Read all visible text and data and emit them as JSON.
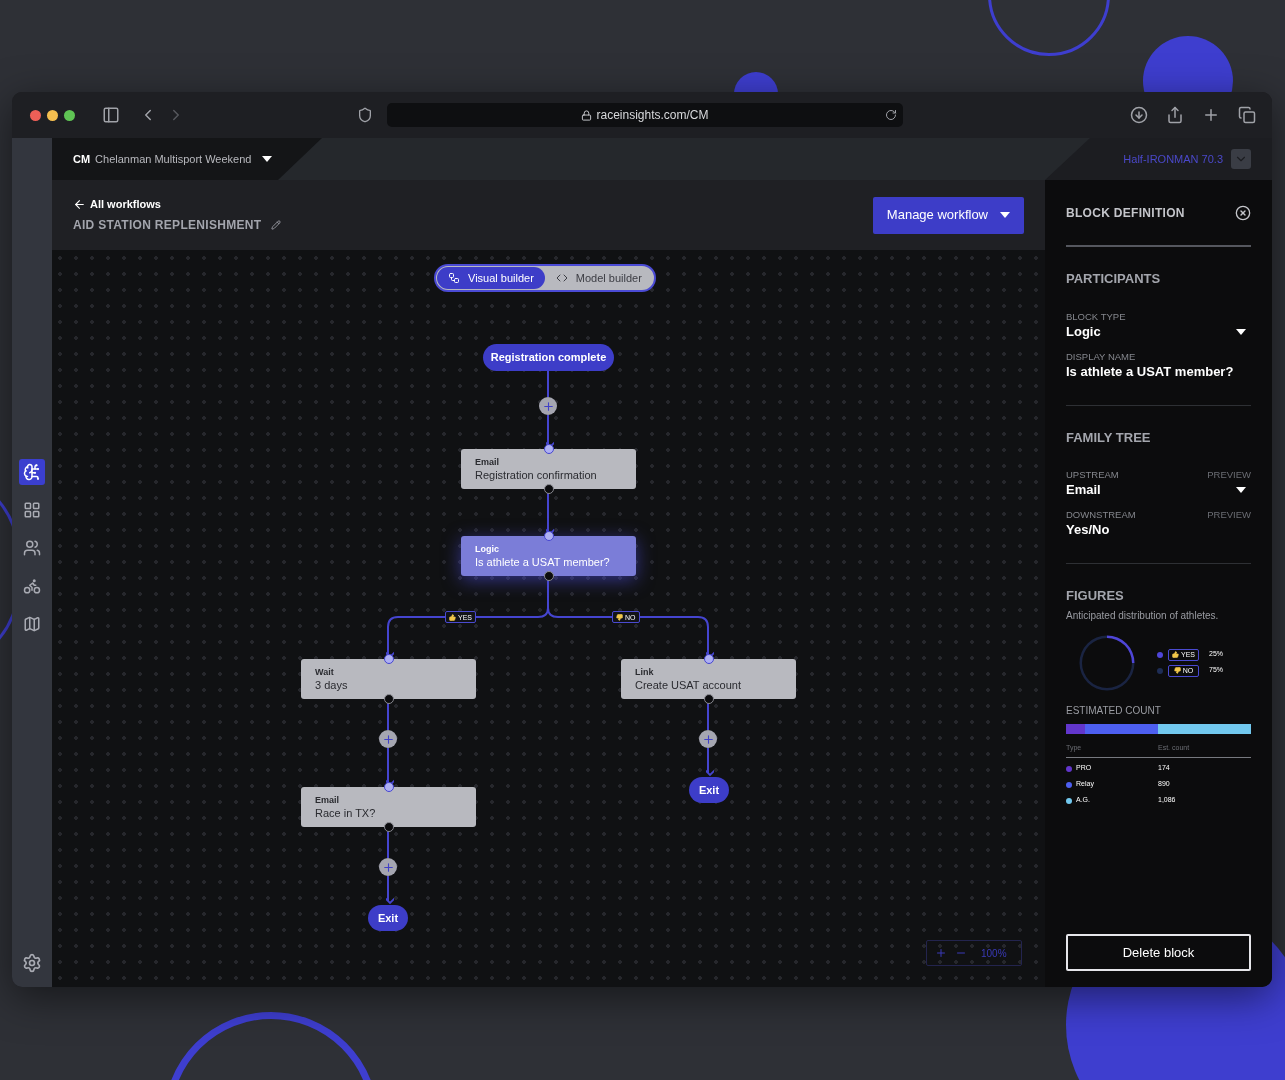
{
  "browser": {
    "url": "raceinsights.com/CM"
  },
  "event_selector": {
    "code": "CM",
    "name": "Chelanman Multisport Weekend"
  },
  "race_selector": {
    "label": "Half-IRONMAN 70.3"
  },
  "sidebar": {
    "items": [
      {
        "selected": true
      },
      {
        "selected": false
      },
      {
        "selected": false
      },
      {
        "selected": false
      },
      {
        "selected": false
      }
    ]
  },
  "header": {
    "back_link": "All workflows",
    "title": "AID STATION REPLENISHMENT",
    "action": "Manage workflow"
  },
  "builder_tabs": [
    {
      "label": "Visual builder",
      "selected": true
    },
    {
      "label": "Model builder",
      "selected": false
    }
  ],
  "flow": {
    "nodes": [
      {
        "kind": "trigger",
        "title": "Registration complete"
      },
      {
        "kind": "block",
        "type": "Email",
        "title": "Registration confirmation",
        "selected": false
      },
      {
        "kind": "block",
        "type": "Logic",
        "title": "Is athlete a USAT member?",
        "selected": true
      },
      {
        "kind": "block",
        "type": "Wait",
        "title": "3 days",
        "selected": false
      },
      {
        "kind": "block",
        "type": "Link",
        "title": "Create USAT account",
        "selected": false
      },
      {
        "kind": "block",
        "type": "Email",
        "title": "Race in TX?",
        "selected": false
      },
      {
        "kind": "exit",
        "title": "Exit"
      },
      {
        "kind": "exit",
        "title": "Exit"
      }
    ],
    "branches": [
      {
        "label": "YES"
      },
      {
        "label": "NO"
      }
    ]
  },
  "zoom": {
    "label": "100%"
  },
  "panel": {
    "title": "BLOCK DEFINITION",
    "sections": [
      {
        "heading": "PARTICIPANTS",
        "fields": [
          {
            "kind": "dropdown",
            "label": "BLOCK TYPE",
            "value": "Logic"
          },
          {
            "kind": "text",
            "label": "DISPLAY NAME",
            "value": "Is athlete a USAT member?"
          }
        ]
      },
      {
        "heading": "FAMILY TREE",
        "fields": [
          {
            "kind": "dropdown",
            "label": "UPSTREAM",
            "value": "Email",
            "action": "PREVIEW"
          },
          {
            "kind": "text",
            "label": "DOWNSTREAM",
            "value": "Yes/No",
            "action": "PREVIEW"
          }
        ]
      }
    ],
    "figures": {
      "heading": "FIGURES",
      "subtitle": "Anticipated distribution of athletes.",
      "chart_data": {
        "type": "donut",
        "categories": [
          "YES",
          "NO"
        ],
        "values": [
          25,
          75
        ],
        "value_labels": [
          "25%",
          "75%"
        ]
      }
    },
    "estimated_count": {
      "heading": "ESTIMATED COUNT",
      "columns": [
        "Type",
        "Est. count"
      ],
      "rows": [
        {
          "type": "PRO",
          "count": "174",
          "color": "#6236cc"
        },
        {
          "type": "Relay",
          "count": "890",
          "color": "#4d5ff0"
        },
        {
          "type": "A.G.",
          "count": "1,086",
          "color": "#72c8ee"
        }
      ]
    },
    "delete_button": "Delete block"
  }
}
